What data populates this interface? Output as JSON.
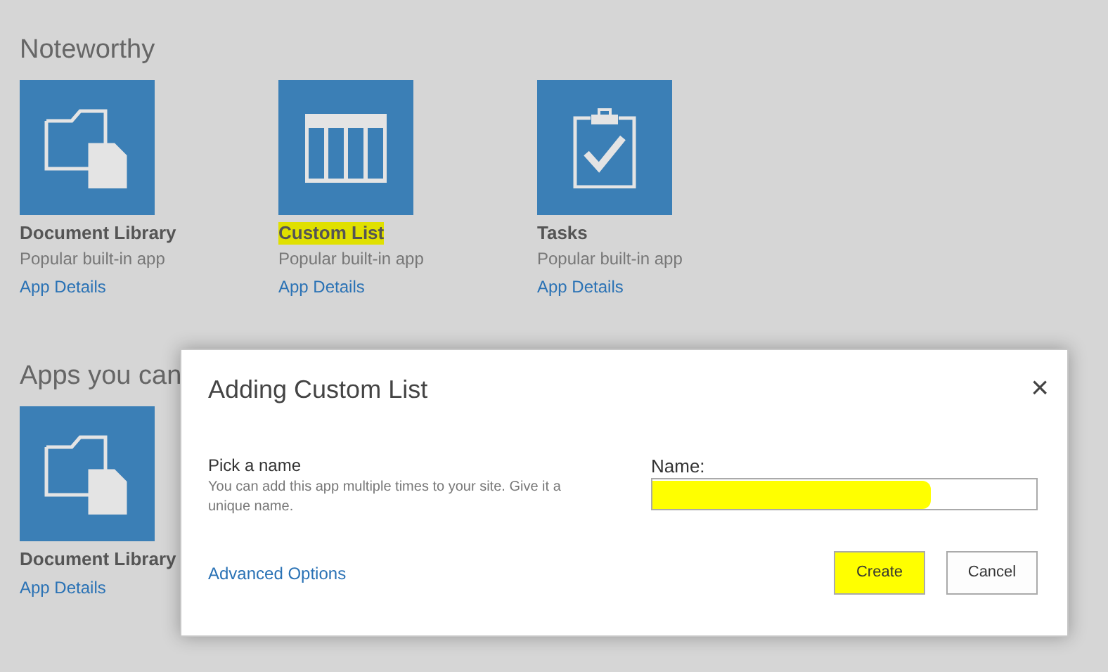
{
  "sections": [
    {
      "heading": "Noteworthy",
      "apps": [
        {
          "kind": "library",
          "title": "Document Library",
          "subtitle": "Popular built-in app",
          "link": "App Details",
          "highlighted": false
        },
        {
          "kind": "list",
          "title": "Custom List",
          "subtitle": "Popular built-in app",
          "link": "App Details",
          "highlighted": true
        },
        {
          "kind": "tasks",
          "title": "Tasks",
          "subtitle": "Popular built-in app",
          "link": "App Details",
          "highlighted": false
        }
      ]
    },
    {
      "heading": "Apps you can",
      "apps": [
        {
          "kind": "library",
          "title": "Document Library",
          "link": "App Details",
          "highlighted": false
        }
      ]
    }
  ],
  "dialog": {
    "title": "Adding Custom List",
    "close": "×",
    "section_title": "Pick a name",
    "description": "You can add this app multiple times to your site. Give it a unique name.",
    "field_label": "Name:",
    "field_highlighted": true,
    "advanced_link": "Advanced Options",
    "buttons": [
      {
        "label": "Create",
        "highlighted": true
      },
      {
        "label": "Cancel",
        "highlighted": false
      }
    ]
  }
}
